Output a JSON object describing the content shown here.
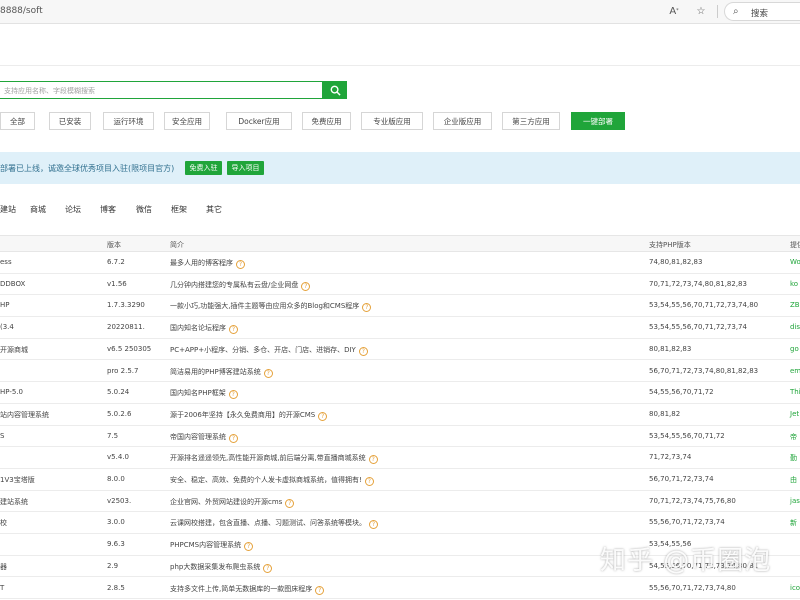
{
  "browser": {
    "url": "8888/soft",
    "search_label": "搜索"
  },
  "search": {
    "placeholder": "支持应用名称、字段模糊搜索"
  },
  "categories": [
    "全部",
    "已安装",
    "运行环境",
    "安全应用",
    "Docker应用",
    "免费应用",
    "专业版应用",
    "企业版应用",
    "第三方应用"
  ],
  "deploy_button": "一键部署",
  "banner": {
    "text": "部署已上线，诚邀全球优秀项目入驻(限项目官方)",
    "free_join": "免费入驻",
    "import_project": "导入项目"
  },
  "subtabs": [
    "建站",
    "商城",
    "论坛",
    "博客",
    "微信",
    "框架",
    "其它"
  ],
  "table": {
    "headers": {
      "name": "",
      "version": "版本",
      "desc": "简介",
      "php": "支持PHP版本",
      "by": "提供"
    },
    "rows": [
      {
        "name": "ess",
        "version": "6.7.2",
        "desc": "最多人用的博客程序",
        "php": "74,80,81,82,83",
        "by": "Wo"
      },
      {
        "name": "DDBOX",
        "version": "v1.56",
        "desc": "几分钟内搭建您的专属私有云盘/企业网盘",
        "php": "70,71,72,73,74,80,81,82,83",
        "by": "ko"
      },
      {
        "name": "HP",
        "version": "1.7.3.3290",
        "desc": "一款小巧,功能强大,插件主题等由应用众多的Blog和CMS程序",
        "php": "53,54,55,56,70,71,72,73,74,80",
        "by": "ZB"
      },
      {
        "name": "(3.4",
        "version": "20220811.",
        "desc": "国内知名论坛程序",
        "php": "53,54,55,56,70,71,72,73,74",
        "by": "dis"
      },
      {
        "name": "开源商城",
        "version": "v6.5 250305",
        "desc": "PC+APP+小程序、分销、多仓、开店、门店、进销存、DIY",
        "php": "80,81,82,83",
        "by": "go"
      },
      {
        "name": "",
        "version": "pro 2.5.7",
        "desc": "简洁易用的PHP博客建站系统",
        "php": "56,70,71,72,73,74,80,81,82,83",
        "by": "em"
      },
      {
        "name": "HP-5.0",
        "version": "5.0.24",
        "desc": "国内知名PHP框架",
        "php": "54,55,56,70,71,72",
        "by": "Thi"
      },
      {
        "name": "站内容管理系统",
        "version": "5.0.2.6",
        "desc": "源于2006年坚持【永久免费商用】的开源CMS",
        "php": "80,81,82",
        "by": "Jet"
      },
      {
        "name": "S",
        "version": "7.5",
        "desc": "帝国内容管理系统",
        "php": "53,54,55,56,70,71,72",
        "by": "帝"
      },
      {
        "name": "",
        "version": "v5.4.0",
        "desc": "开源排名遥遥领先,高性能开源商城,前后端分离,带直播商城系统",
        "php": "71,72,73,74",
        "by": "勤"
      },
      {
        "name": "1V3宝塔版",
        "version": "8.0.0",
        "desc": "安全、稳定、高效、免费的个人发卡虚拟商城系统，值得拥有!",
        "php": "56,70,71,72,73,74",
        "by": "由"
      },
      {
        "name": "建站系统",
        "version": "v2503.",
        "desc": "企业官网、外贸网站建设的开源cms",
        "php": "70,71,72,73,74,75,76,80",
        "by": "jas"
      },
      {
        "name": "校",
        "version": "3.0.0",
        "desc": "云课网校搭建，包含直播、点播、习题测试、问答系统等模块。",
        "php": "55,56,70,71,72,73,74",
        "by": "新"
      },
      {
        "name": "",
        "version": "9.6.3",
        "desc": "PHPCMS内容管理系统",
        "php": "53,54,55,56",
        "by": ""
      },
      {
        "name": "器",
        "version": "2.9",
        "desc": "php大数据采集发布爬虫系统",
        "php": "54,55,56,70,71,72,73,74,80,81",
        "by": ""
      },
      {
        "name": "T",
        "version": "2.8.5",
        "desc": "支持多文件上传,简单无数据库的一款图床程序",
        "php": "55,56,70,71,72,73,74,80",
        "by": "ico"
      }
    ],
    "help_rows": [
      0,
      1,
      2,
      3,
      4,
      5,
      6,
      7,
      8,
      9,
      10,
      11,
      12,
      13,
      14,
      15
    ]
  },
  "watermark": "知乎 @币圈泡"
}
